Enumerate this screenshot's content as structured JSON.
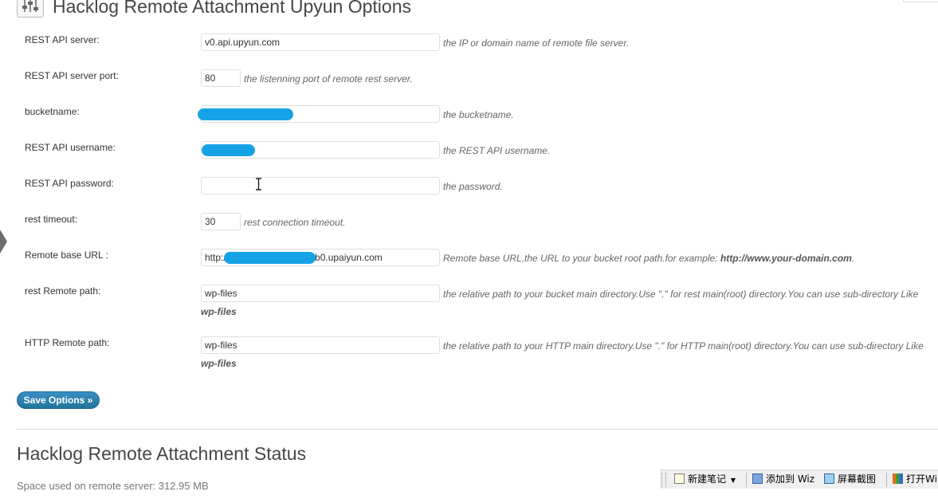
{
  "page": {
    "title": "Hacklog Remote Attachment Upyun Options"
  },
  "fields": [
    {
      "label": "REST API server:",
      "value": "v0.api.upyun.com",
      "desc": "the IP or domain name of remote file server."
    },
    {
      "label": "REST API server port:",
      "value": "80",
      "desc": "the listenning port of remote rest server."
    },
    {
      "label": "bucketname:",
      "value": "",
      "desc": "the bucketname."
    },
    {
      "label": "REST API username:",
      "value": "",
      "desc": "the REST API username."
    },
    {
      "label": "REST API password:",
      "value": "",
      "desc": "the password."
    },
    {
      "label": "rest timeout:",
      "value": "30",
      "desc": "rest connection timeout."
    },
    {
      "label": "Remote base URL :",
      "value_prefix": "http:/",
      "value_suffix": ".b0.upaiyun.com",
      "desc": "Remote base URL,the URL to your bucket root path.for example:",
      "desc_example": "http://www.your-domain.com",
      "desc_end": "."
    },
    {
      "label": "rest Remote path:",
      "value": "wp-files",
      "desc": "the relative path to your bucket main directory.Use \".\" for rest main(root) directory.You can use sub-directory Like",
      "desc_cont": "wp-files"
    },
    {
      "label": "HTTP Remote path:",
      "value": "wp-files",
      "desc": "the relative path to your HTTP main directory.Use \".\" for HTTP main(root) directory.You can use sub-directory Like",
      "desc_cont": "wp-files"
    }
  ],
  "save_button": "Save Options »",
  "status": {
    "title": "Hacklog Remote Attachment Status",
    "text": "Space used on remote server: 312.95 MB"
  },
  "wiz_toolbar": {
    "new_note": "新建笔记",
    "add_to_wiz": "添加到 Wiz",
    "screenshot": "屏幕截图",
    "open": "打开Wi"
  },
  "colors": {
    "accent": "#21759b",
    "redaction": "#16a3e6",
    "description": "#666666"
  }
}
